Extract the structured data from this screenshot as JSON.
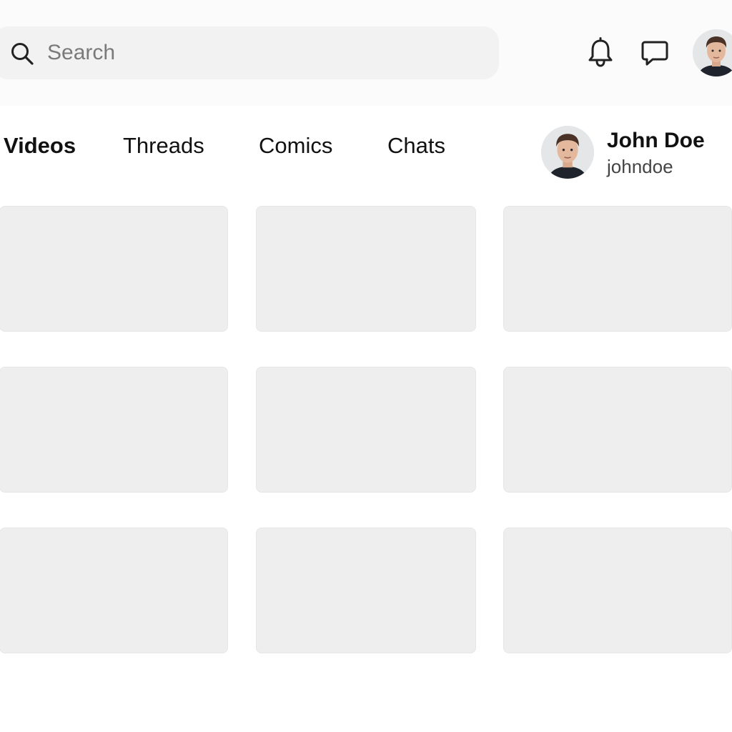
{
  "search": {
    "placeholder": "Search",
    "value": ""
  },
  "header": {
    "icons": [
      "search-icon",
      "bell-icon",
      "chat-bubble-icon",
      "avatar"
    ]
  },
  "tabs": [
    {
      "label": "Videos",
      "active": true
    },
    {
      "label": "Threads",
      "active": false
    },
    {
      "label": "Comics",
      "active": false
    },
    {
      "label": "Chats",
      "active": false
    }
  ],
  "profile": {
    "name": "John Doe",
    "handle": "johndoe"
  },
  "grid": {
    "rows": 3,
    "columns": 3,
    "cards": 9
  },
  "colors": {
    "background": "#ffffff",
    "topbar": "#fbfbfb",
    "search_bg": "#f2f2f2",
    "card_bg": "#eeeeee",
    "text": "#111111"
  }
}
